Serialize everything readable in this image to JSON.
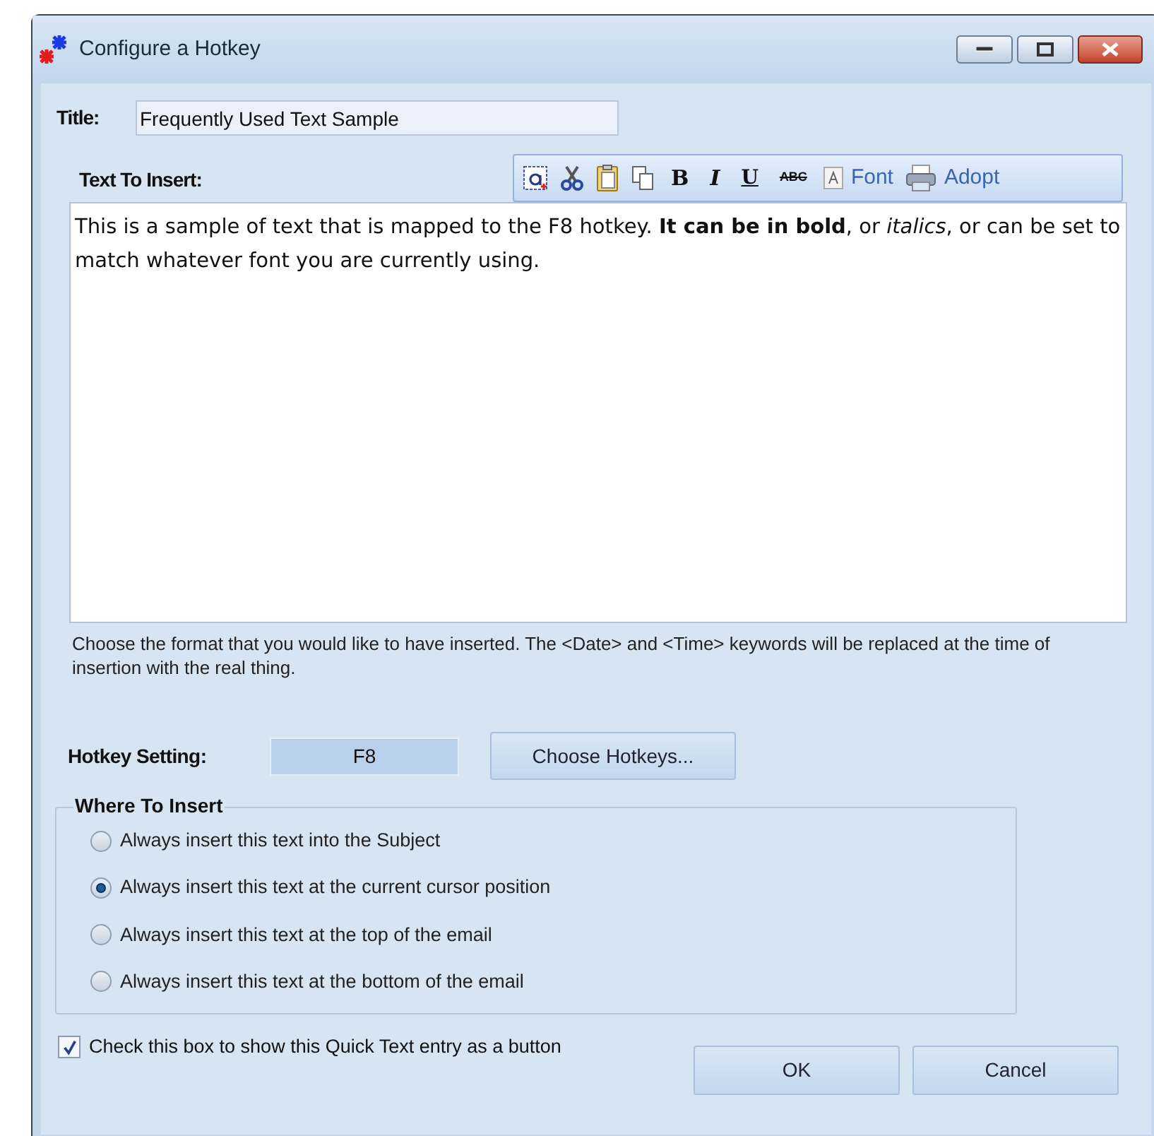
{
  "window": {
    "title": "Configure a Hotkey"
  },
  "title_field": {
    "label": "Title:",
    "value": "Frequently Used Text Sample"
  },
  "text_to_insert": {
    "label": "Text To Insert:",
    "toolbar": [
      {
        "kind": "select-all"
      },
      {
        "kind": "cut"
      },
      {
        "kind": "paste"
      },
      {
        "kind": "copy"
      },
      {
        "kind": "bold",
        "text": "B"
      },
      {
        "kind": "italic",
        "text": "I"
      },
      {
        "kind": "underline",
        "text": "U"
      },
      {
        "kind": "strike",
        "text": "ABC"
      },
      {
        "kind": "font",
        "text": "Font"
      },
      {
        "kind": "adopt",
        "text": "Adopt"
      }
    ],
    "content": "This is a sample of text that is mapped to the F8 hotkey.  **It can be in bold**, or *italics*, or can be set to match whatever font you are currently using."
  },
  "help_text": "Choose the format that you would like to have inserted.  The <Date> and <Time> keywords will be replaced at the time of insertion with the real thing.",
  "hotkey": {
    "label": "Hotkey Setting:",
    "value": "F8",
    "button": {
      "label": "Choose Hotkeys..."
    }
  },
  "where_to_insert": {
    "legend": "Where To Insert",
    "options": [
      {
        "label": "Always insert this text into the Subject",
        "selected": false
      },
      {
        "label": "Always insert this text at the current cursor position",
        "selected": true
      },
      {
        "label": "Always insert this text at the top of the email",
        "selected": false
      },
      {
        "label": "Always insert this text at the bottom of the email",
        "selected": false
      }
    ]
  },
  "show_as_button": {
    "label": "Check this box to show this Quick Text entry as a button",
    "checked": true
  },
  "buttons": [
    {
      "label": "OK"
    },
    {
      "label": "Cancel"
    }
  ]
}
